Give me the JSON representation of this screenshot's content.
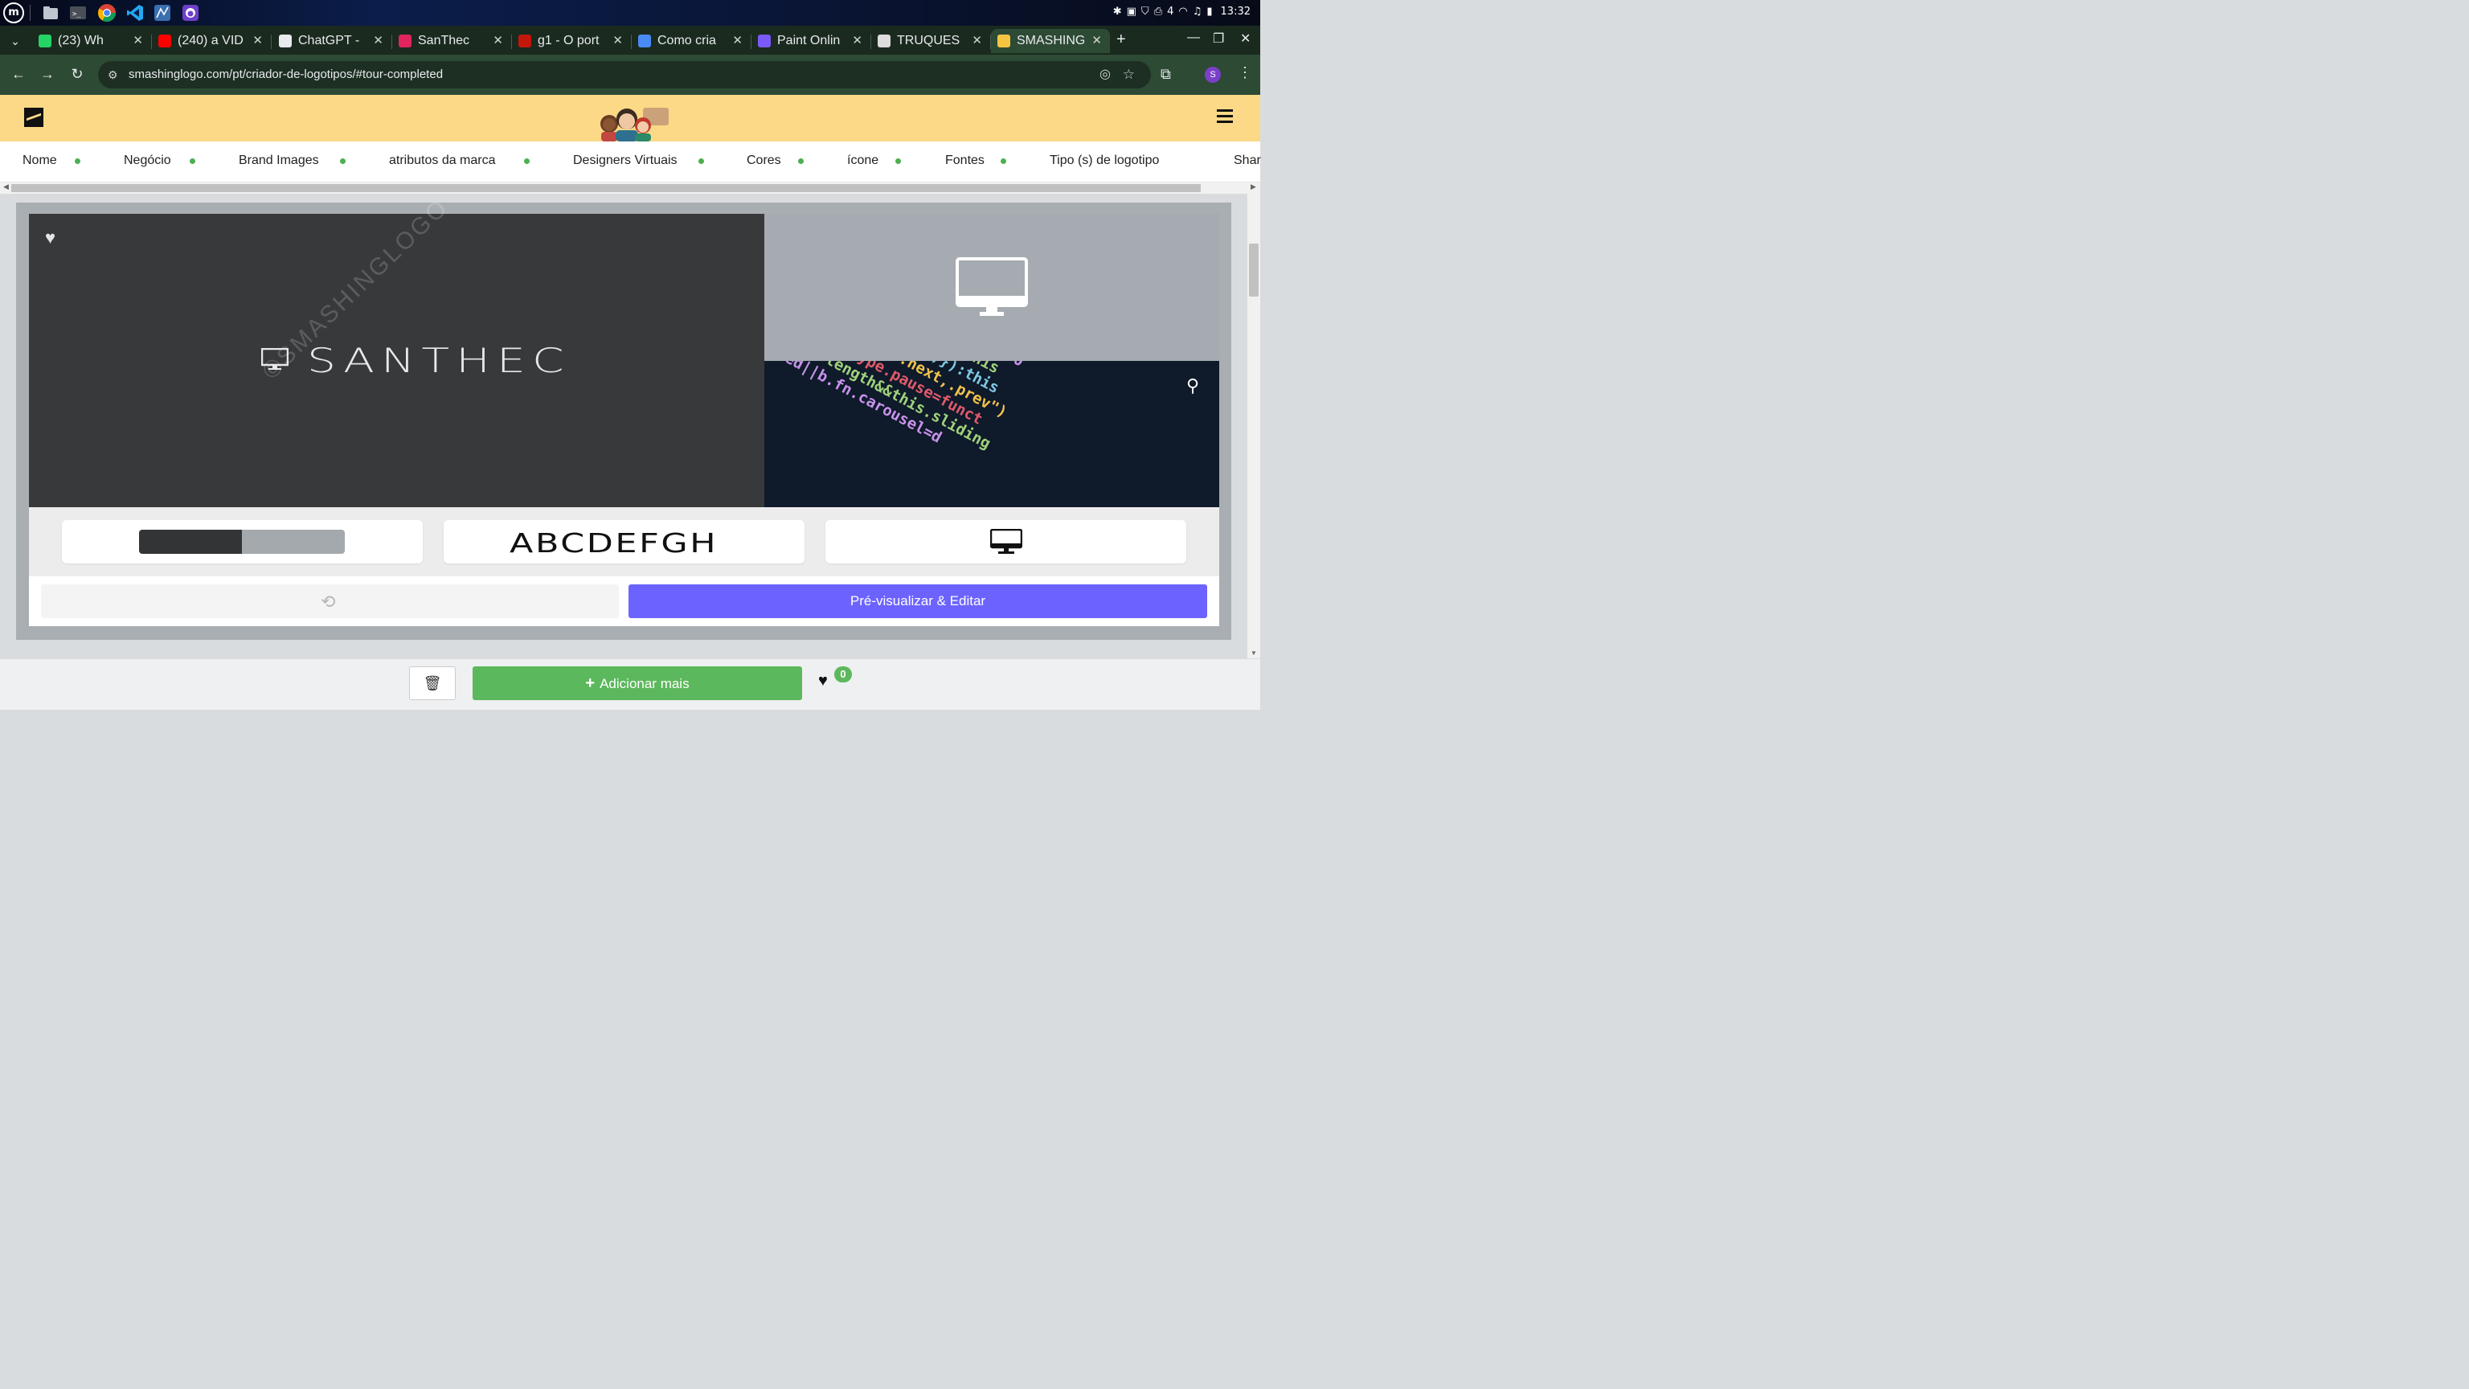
{
  "os": {
    "apps": [
      "mint-menu-icon",
      "files-icon",
      "terminal-icon",
      "chrome-icon",
      "vscode-icon",
      "mysql-workbench-icon",
      "github-desktop-icon"
    ],
    "tray_battery": "4",
    "clock": "13:32"
  },
  "tabs": [
    {
      "title": "(23) Wh",
      "fav_color": "#25d366",
      "icon": "whatsapp-icon"
    },
    {
      "title": "(240) a VID",
      "fav_color": "#ff0000",
      "icon": "youtube-icon"
    },
    {
      "title": "ChatGPT -",
      "fav_color": "#e8eaed",
      "icon": "chatgpt-icon"
    },
    {
      "title": "SanThec",
      "fav_color": "#e0245e",
      "icon": "angular-icon"
    },
    {
      "title": "g1 - O port",
      "fav_color": "#c4170c",
      "icon": "g1-icon"
    },
    {
      "title": "Como cria",
      "fav_color": "#4a8af4",
      "icon": "docs-icon"
    },
    {
      "title": "Paint Onlin",
      "fav_color": "#7a5af8",
      "icon": "paint-icon"
    },
    {
      "title": "TRUQUES",
      "fav_color": "#dddddd",
      "icon": "truques-icon"
    },
    {
      "title": "SMASHING",
      "fav_color": "#f5c542",
      "icon": "smashing-icon"
    }
  ],
  "address": {
    "url": "smashinglogo.com/pt/criador-de-logotipos/#tour-completed",
    "profile_initial": "S"
  },
  "steps": [
    "Nome",
    "Negócio",
    "Brand Images",
    "atributos da marca",
    "Designers Virtuais",
    "Cores",
    "ícone",
    "Fontes",
    "Tipo (s) de logotipo",
    "Shar"
  ],
  "preview": {
    "brand_name": "SANTHEC",
    "watermark": "©SMASHINGLOGO",
    "font_sample": "ABCDEFGH",
    "colors": [
      "#323436",
      "#a3a9ad"
    ],
    "edit_button": "Pré-visualizar & Editar"
  },
  "bottom": {
    "add_more": "Adicionar mais",
    "favorites_count": "0"
  },
  "theme": {
    "header_bg": "#fbd986",
    "accent_purple": "#6c63ff",
    "accent_green": "#5cb85c",
    "step_dot": "#4caf50"
  }
}
